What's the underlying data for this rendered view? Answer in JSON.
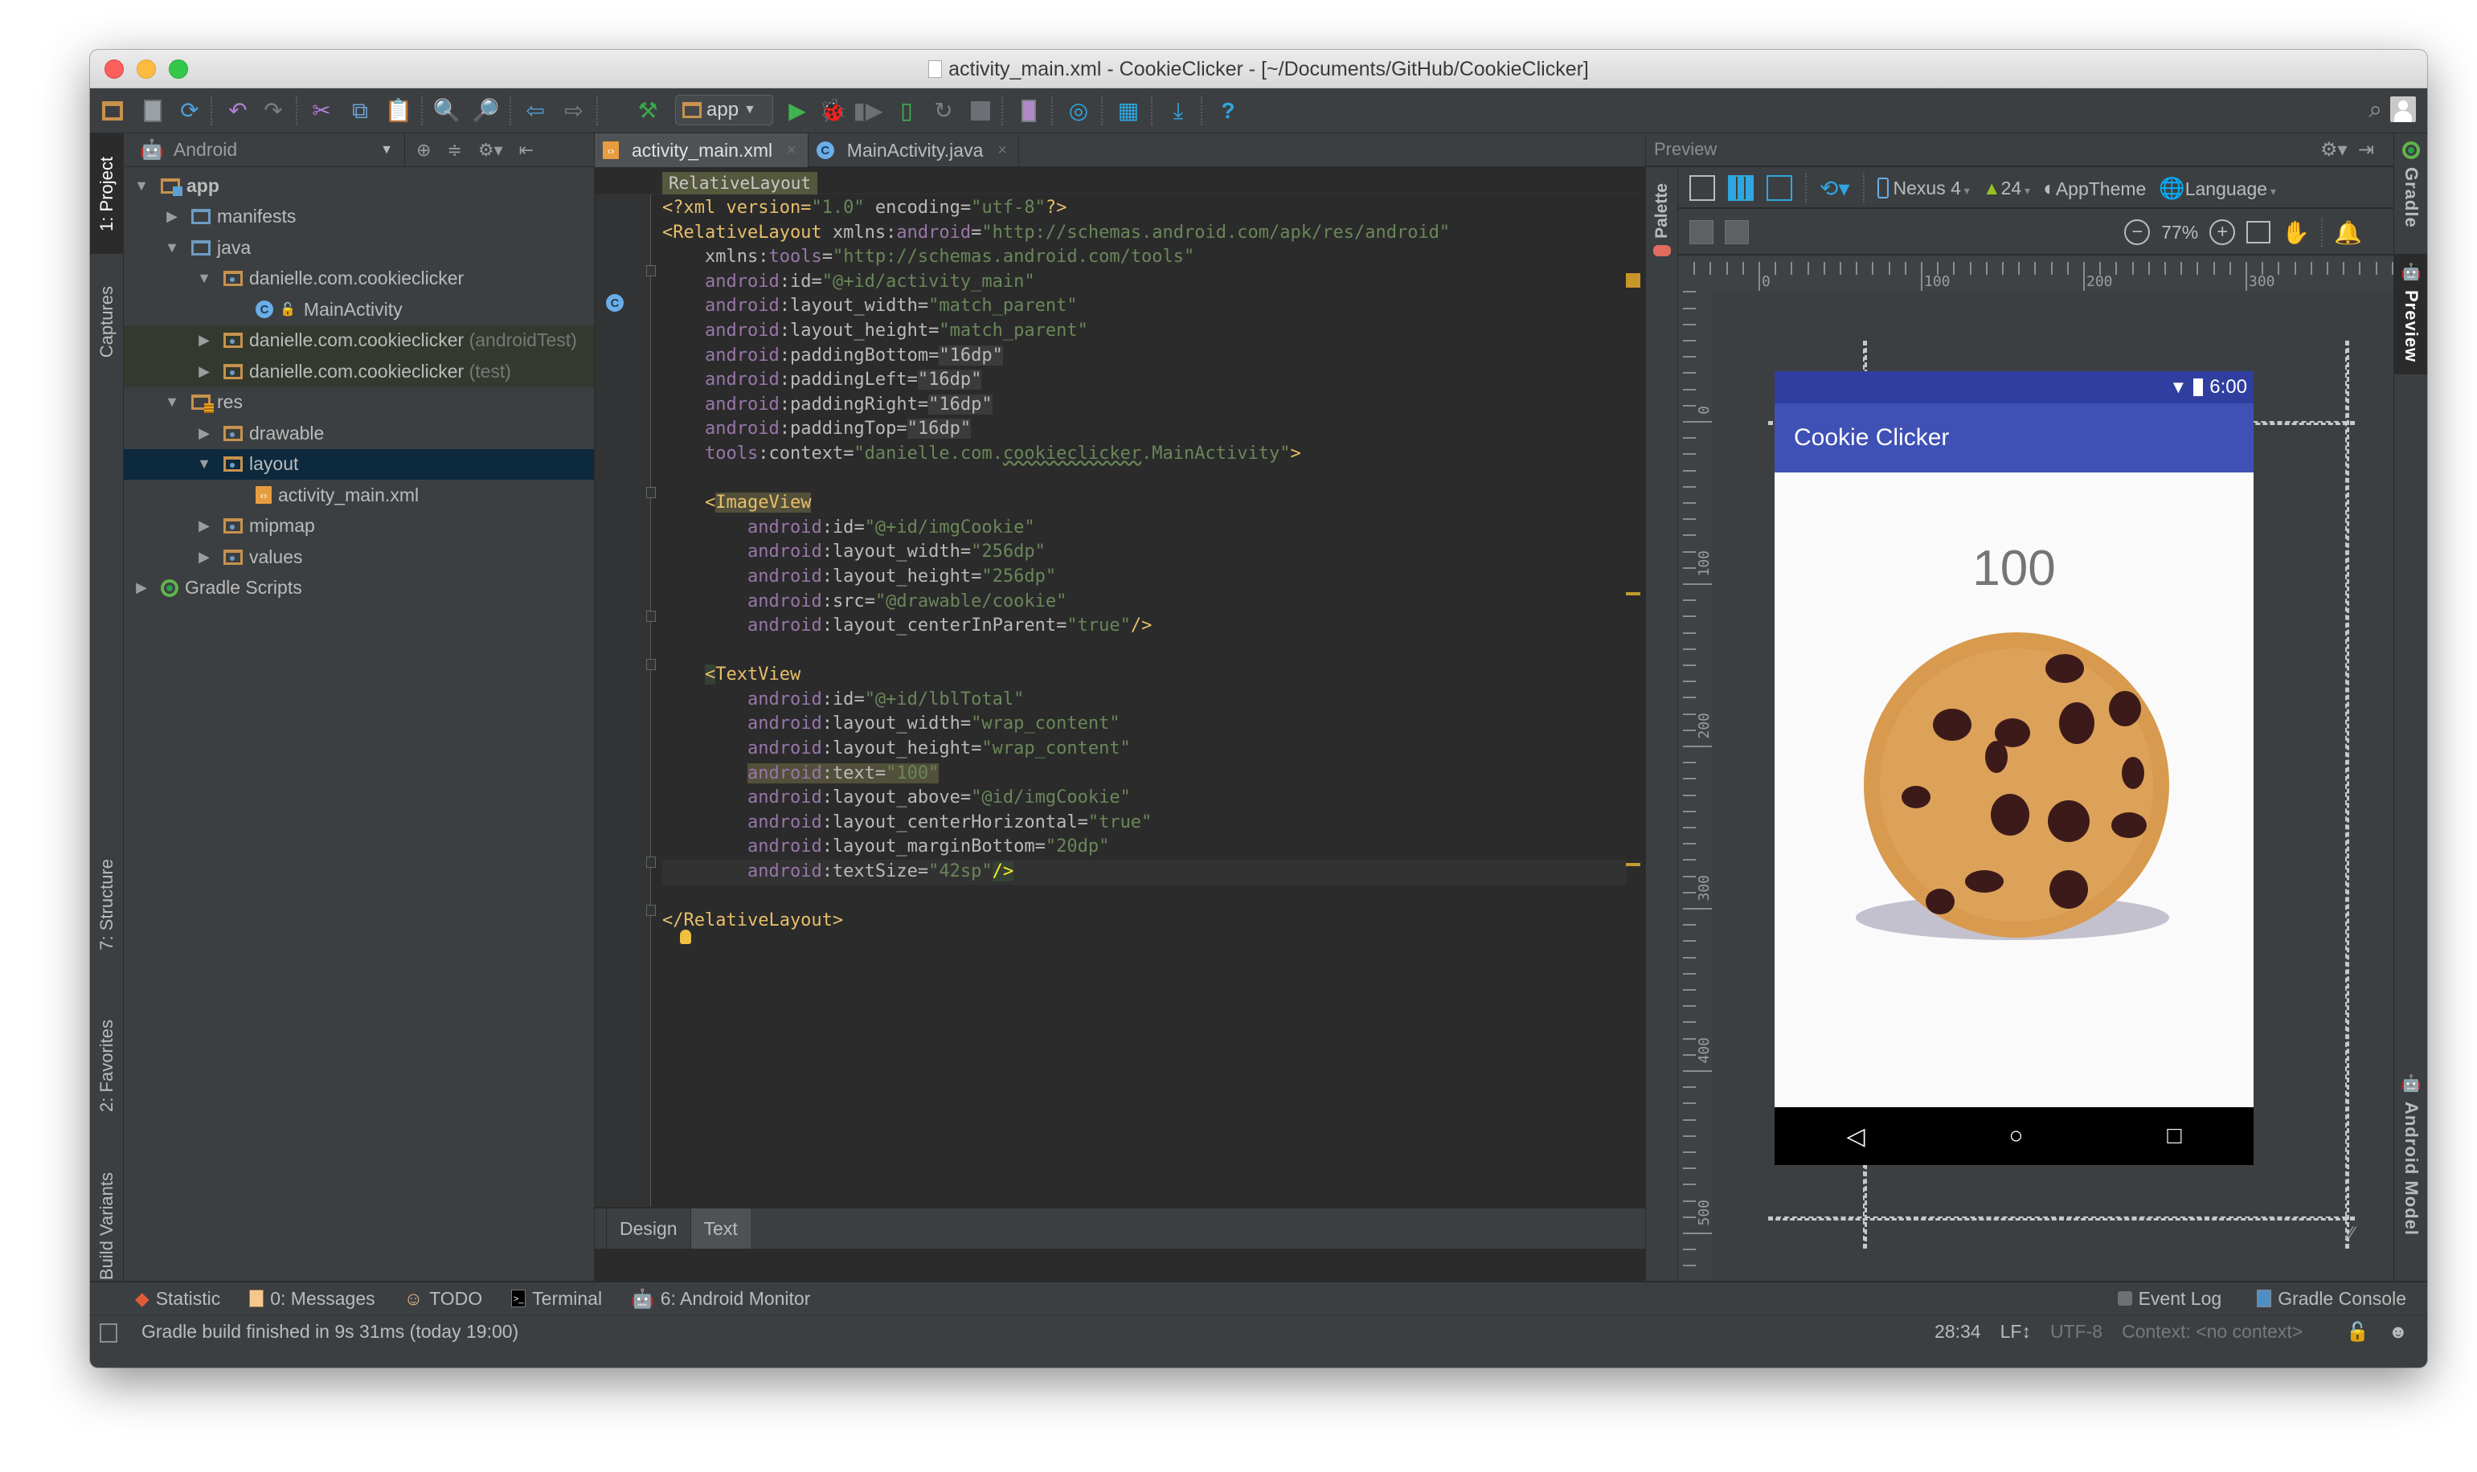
{
  "window": {
    "title": "activity_main.xml - CookieClicker - [~/Documents/GitHub/CookieClicker]"
  },
  "toolbar": {
    "run_config": "app",
    "icons": [
      "open-folder-icon",
      "save-icon",
      "sync-icon",
      "undo-icon",
      "redo-icon",
      "cut-icon",
      "copy-icon",
      "paste-icon",
      "find-icon",
      "replace-icon",
      "back-icon",
      "forward-icon",
      "make-project-icon",
      "run-icon",
      "debug-icon",
      "profile-icon",
      "attach-debugger-icon",
      "apply-changes-icon",
      "stop-icon",
      "avd-manager-icon",
      "sync-gradle-icon",
      "project-structure-icon",
      "sdk-manager-icon",
      "help-icon"
    ]
  },
  "left_strip": {
    "tabs": [
      {
        "label": "1: Project",
        "active": true
      },
      {
        "label": "Captures"
      },
      {
        "label": "7: Structure"
      },
      {
        "label": "2: Favorites"
      },
      {
        "label": "Build Variants"
      }
    ]
  },
  "project_panel": {
    "view_mode": "Android",
    "tree": [
      {
        "label": "app",
        "depth": 0,
        "expanded": true,
        "icon": "module-folder"
      },
      {
        "label": "manifests",
        "depth": 1,
        "expanded": false,
        "icon": "folder"
      },
      {
        "label": "java",
        "depth": 1,
        "expanded": true,
        "icon": "folder"
      },
      {
        "label": "danielle.com.cookieclicker",
        "depth": 2,
        "expanded": true,
        "icon": "package"
      },
      {
        "label": "MainActivity",
        "depth": 3,
        "icon": "class"
      },
      {
        "label": "danielle.com.cookieclicker",
        "suffix": "(androidTest)",
        "depth": 2,
        "expanded": false,
        "icon": "package"
      },
      {
        "label": "danielle.com.cookieclicker",
        "suffix": "(test)",
        "depth": 2,
        "expanded": false,
        "icon": "package"
      },
      {
        "label": "res",
        "depth": 1,
        "expanded": true,
        "icon": "res-folder"
      },
      {
        "label": "drawable",
        "depth": 2,
        "expanded": false,
        "icon": "package"
      },
      {
        "label": "layout",
        "depth": 2,
        "expanded": true,
        "icon": "package",
        "selected": true
      },
      {
        "label": "activity_main.xml",
        "depth": 3,
        "icon": "xml"
      },
      {
        "label": "mipmap",
        "depth": 2,
        "expanded": false,
        "icon": "package"
      },
      {
        "label": "values",
        "depth": 2,
        "expanded": false,
        "icon": "package"
      },
      {
        "label": "Gradle Scripts",
        "depth": 0,
        "expanded": false,
        "icon": "gradle"
      }
    ]
  },
  "editor": {
    "tabs": [
      {
        "label": "activity_main.xml",
        "active": true
      },
      {
        "label": "MainActivity.java"
      }
    ],
    "breadcrumb": "RelativeLayout",
    "bottom_tabs": [
      {
        "label": "Design"
      },
      {
        "label": "Text",
        "active": true
      }
    ],
    "code": {
      "l1_a": "<?xml version=",
      "l1_b": "\"1.0\"",
      "l1_c": " encoding=",
      "l1_d": "\"utf-8\"",
      "l1_e": "?>",
      "l2_tag": "<RelativeLayout",
      "l2_ns": "xmlns:",
      "l2_attr": "android",
      "l2_val": "\"http://schemas.android.com/apk/res/android\"",
      "l3_attr": "tools",
      "l3_val": "\"http://schemas.android.com/tools\"",
      "l4": [
        "id",
        "\"@+id/activity_main\""
      ],
      "l5": [
        "layout_width",
        "\"match_parent\""
      ],
      "l6": [
        "layout_height",
        "\"match_parent\""
      ],
      "l7": [
        "paddingBottom",
        "\"16dp\""
      ],
      "l8": [
        "paddingLeft",
        "\"16dp\""
      ],
      "l9": [
        "paddingRight",
        "\"16dp\""
      ],
      "l10": [
        "paddingTop",
        "\"16dp\""
      ],
      "l11_attr": "context",
      "l11_v1": "\"danielle.com.",
      "l11_v2": "cookieclicker",
      "l11_v3": ".MainActivity\"",
      "l13_tag": "ImageView",
      "l14": [
        "id",
        "\"@+id/imgCookie\""
      ],
      "l15": [
        "layout_width",
        "\"256dp\""
      ],
      "l16": [
        "layout_height",
        "\"256dp\""
      ],
      "l17": [
        "src",
        "\"@drawable/cookie\""
      ],
      "l18": [
        "layout_centerInParent",
        "\"true\""
      ],
      "l20_tag": "TextView",
      "l21": [
        "id",
        "\"@+id/lblTotal\""
      ],
      "l22": [
        "layout_width",
        "\"wrap_content\""
      ],
      "l23": [
        "layout_height",
        "\"wrap_content\""
      ],
      "l24": [
        "text",
        "\"100\""
      ],
      "l25": [
        "layout_above",
        "\"@id/imgCookie\""
      ],
      "l26": [
        "layout_centerHorizontal",
        "\"true\""
      ],
      "l27": [
        "layout_marginBottom",
        "\"20dp\""
      ],
      "l28": [
        "textSize",
        "\"42sp\""
      ],
      "l30": "</RelativeLayout>",
      "android_ns": "android",
      "tools_ns": "tools",
      "eq": "=",
      "colon": ":",
      "lt": "<",
      "close_gt": ">",
      "self_close": "/>"
    }
  },
  "preview": {
    "title": "Preview",
    "device": "Nexus 4",
    "api_level": "24",
    "theme": "AppTheme",
    "language": "Language",
    "zoom": "77%",
    "ruler_h_labels": [
      "0",
      "100",
      "200",
      "300"
    ],
    "ruler_v_labels": [
      "0",
      "100",
      "200",
      "300",
      "400",
      "500"
    ],
    "phone": {
      "time": "6:00",
      "app_title": "Cookie Clicker",
      "counter": "100"
    },
    "palette_label": "Palette"
  },
  "right_strip": {
    "tabs": [
      {
        "label": "Gradle"
      },
      {
        "label": "Preview",
        "active": true
      },
      {
        "label": "Android Model"
      }
    ]
  },
  "bottom_tools": {
    "left": [
      {
        "label": "Statistic"
      },
      {
        "label": "0: Messages"
      },
      {
        "label": "TODO"
      },
      {
        "label": "Terminal"
      },
      {
        "label": "6: Android Monitor"
      }
    ],
    "right": [
      {
        "label": "Event Log"
      },
      {
        "label": "Gradle Console"
      }
    ]
  },
  "status_bar": {
    "message": "Gradle build finished in 9s 31ms (today 19:00)",
    "position": "28:34",
    "line_sep": "LF↕",
    "encoding": "UTF-8",
    "context": "Context: <no context>"
  }
}
